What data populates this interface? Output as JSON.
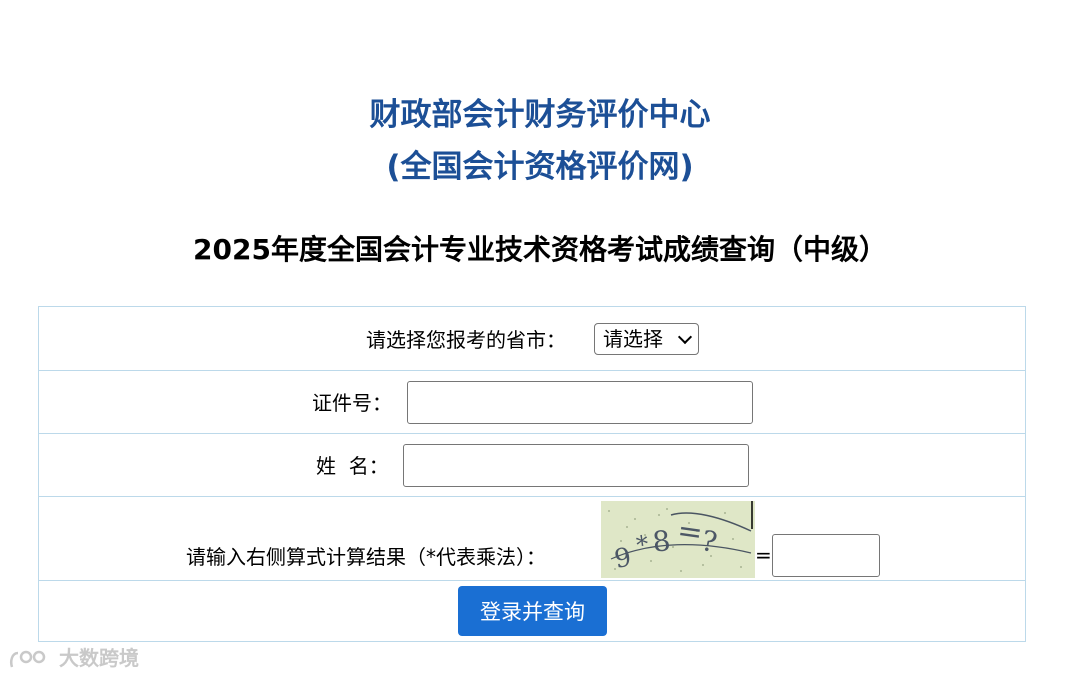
{
  "header": {
    "org_line1": "财政部会计财务评价中心",
    "org_line2": "(全国会计资格评价网)",
    "exam_title": "2025年度全国会计专业技术资格考试成绩查询（中级）"
  },
  "form": {
    "province_label": "请选择您报考的省市：",
    "province_select_value": "请选择",
    "id_label": "证件号：",
    "id_value": "",
    "name_label": "姓  名：",
    "name_value": "",
    "captcha_label": "请输入右侧算式计算结果（*代表乘法）：",
    "captcha_image_text": "9*8=?",
    "captcha_equals": "=",
    "captcha_value": "",
    "submit_label": "登录并查询"
  },
  "watermark": {
    "text": "大数跨境"
  },
  "colors": {
    "org_title": "#1c4f96",
    "table_border": "#bcd9ea",
    "submit_bg": "#1a6fd3"
  }
}
